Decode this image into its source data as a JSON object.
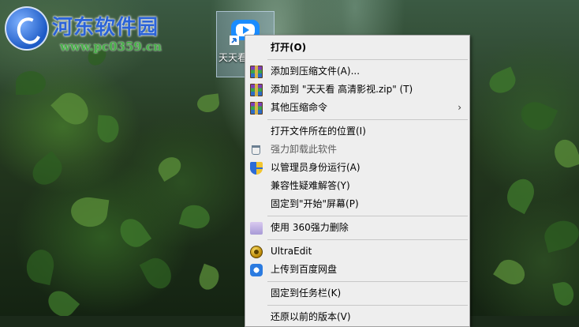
{
  "watermark": {
    "site_name": "河东软件园",
    "site_url": "www.pc0359.cn"
  },
  "desktop_icon": {
    "label": "天天看 高清影视",
    "icon": "tiantiankan-app-icon"
  },
  "context_menu": {
    "items": [
      {
        "label": "打开(O)",
        "icon": "",
        "bold": true
      },
      {
        "separator": true
      },
      {
        "label": "添加到压缩文件(A)...",
        "icon": "winrar-icon"
      },
      {
        "label": "添加到 \"天天看 高清影视.zip\" (T)",
        "icon": "winrar-icon"
      },
      {
        "label": "其他压缩命令",
        "icon": "winrar-icon",
        "submenu": true
      },
      {
        "separator": true
      },
      {
        "label": "打开文件所在的位置(I)",
        "icon": ""
      },
      {
        "label": "强力卸载此软件",
        "icon": "trash-icon"
      },
      {
        "label": "以管理员身份运行(A)",
        "icon": "shield-icon"
      },
      {
        "label": "兼容性疑难解答(Y)",
        "icon": ""
      },
      {
        "label": "固定到\"开始\"屏幕(P)",
        "icon": ""
      },
      {
        "separator": true
      },
      {
        "label": "使用 360强力删除",
        "icon": "360-icon"
      },
      {
        "separator": true
      },
      {
        "label": "UltraEdit",
        "icon": "ultraedit-icon"
      },
      {
        "label": "上传到百度网盘",
        "icon": "baidu-netdisk-icon"
      },
      {
        "separator": true
      },
      {
        "label": "固定到任务栏(K)",
        "icon": ""
      },
      {
        "separator": true
      },
      {
        "label": "还原以前的版本(V)",
        "icon": ""
      }
    ],
    "submenu_arrow": "›"
  }
}
